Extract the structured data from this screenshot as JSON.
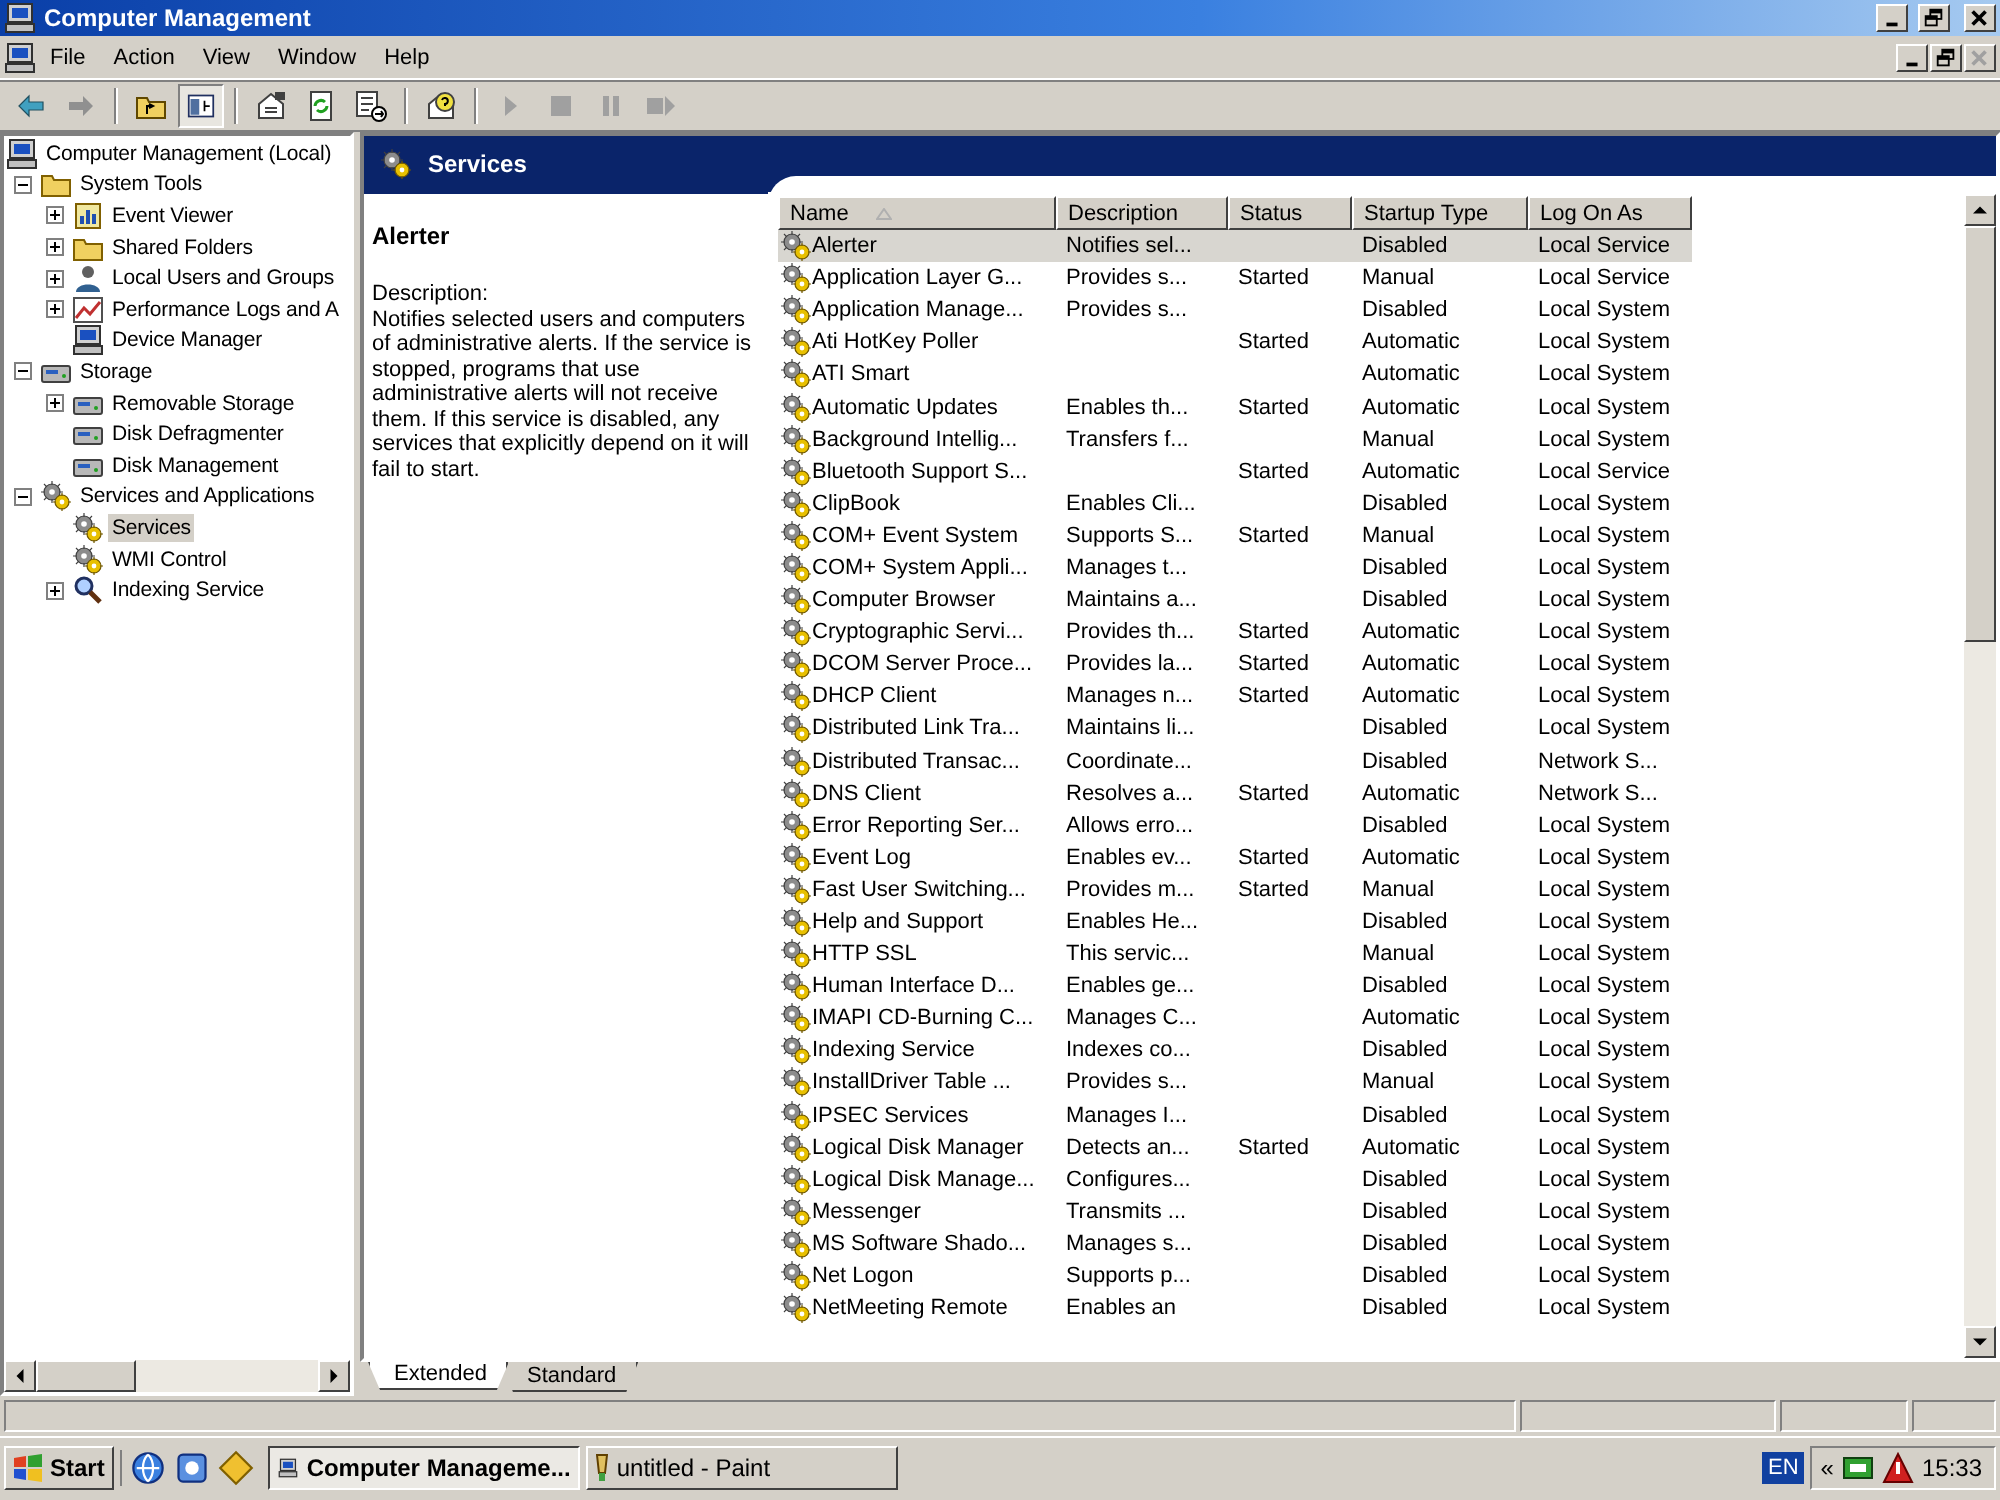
{
  "window": {
    "title": "Computer Management"
  },
  "menu": [
    "File",
    "Action",
    "View",
    "Window",
    "Help"
  ],
  "tree": [
    {
      "label": "Computer Management (Local)",
      "selected": false,
      "children": [
        {
          "label": "System Tools",
          "expanded": true,
          "selected": false,
          "children": [
            {
              "label": "Event Viewer",
              "expanded": false,
              "selected": false
            },
            {
              "label": "Shared Folders",
              "expanded": false,
              "selected": false
            },
            {
              "label": "Local Users and Groups",
              "expanded": false,
              "selected": false
            },
            {
              "label": "Performance Logs and A",
              "expanded": false,
              "selected": false
            },
            {
              "label": "Device Manager",
              "selected": false
            }
          ]
        },
        {
          "label": "Storage",
          "expanded": true,
          "selected": false,
          "children": [
            {
              "label": "Removable Storage",
              "expanded": false,
              "selected": false
            },
            {
              "label": "Disk Defragmenter",
              "selected": false
            },
            {
              "label": "Disk Management",
              "selected": false
            }
          ]
        },
        {
          "label": "Services and Applications",
          "expanded": true,
          "selected": false,
          "children": [
            {
              "label": "Services",
              "selected": true
            },
            {
              "label": "WMI Control",
              "selected": false
            },
            {
              "label": "Indexing Service",
              "expanded": false,
              "selected": false
            }
          ]
        }
      ]
    }
  ],
  "panel": {
    "title": "Services"
  },
  "details": {
    "name": "Alerter",
    "heading": "Description:",
    "text": "Notifies selected users and computers of administrative alerts. If the service is stopped, programs that use administrative alerts will not receive them. If this service is disabled, any services that explicitly depend on it will fail to start."
  },
  "table": {
    "columns": [
      {
        "label": "Name",
        "sorted": true
      },
      {
        "label": "Description",
        "sorted": false
      },
      {
        "label": "Status",
        "sorted": false
      },
      {
        "label": "Startup Type",
        "sorted": false
      },
      {
        "label": "Log On As",
        "sorted": false
      }
    ],
    "rows": [
      {
        "name": "Alerter",
        "description": "Notifies sel...",
        "startup_type": "Disabled",
        "log_on_as": "Local Service",
        "selected": true
      },
      {
        "name": "Application Layer G...",
        "description": "Provides s...",
        "status": "Started",
        "startup_type": "Manual",
        "log_on_as": "Local Service",
        "selected": false
      },
      {
        "name": "Application Manage...",
        "description": "Provides s...",
        "startup_type": "Disabled",
        "log_on_as": "Local System",
        "selected": false
      },
      {
        "name": "Ati HotKey Poller",
        "status": "Started",
        "startup_type": "Automatic",
        "log_on_as": "Local System",
        "selected": false
      },
      {
        "name": "ATI Smart",
        "startup_type": "Automatic",
        "log_on_as": "Local System",
        "selected": false
      },
      {
        "name": "Automatic Updates",
        "description": "Enables th...",
        "status": "Started",
        "startup_type": "Automatic",
        "log_on_as": "Local System",
        "selected": false
      },
      {
        "name": "Background Intellig...",
        "description": "Transfers f...",
        "startup_type": "Manual",
        "log_on_as": "Local System",
        "selected": false
      },
      {
        "name": "Bluetooth Support S...",
        "status": "Started",
        "startup_type": "Automatic",
        "log_on_as": "Local Service",
        "selected": false
      },
      {
        "name": "ClipBook",
        "description": "Enables Cli...",
        "startup_type": "Disabled",
        "log_on_as": "Local System",
        "selected": false
      },
      {
        "name": "COM+ Event System",
        "description": "Supports S...",
        "status": "Started",
        "startup_type": "Manual",
        "log_on_as": "Local System",
        "selected": false
      },
      {
        "name": "COM+ System Appli...",
        "description": "Manages t...",
        "startup_type": "Disabled",
        "log_on_as": "Local System",
        "selected": false
      },
      {
        "name": "Computer Browser",
        "description": "Maintains a...",
        "startup_type": "Disabled",
        "log_on_as": "Local System",
        "selected": false
      },
      {
        "name": "Cryptographic Servi...",
        "description": "Provides th...",
        "status": "Started",
        "startup_type": "Automatic",
        "log_on_as": "Local System",
        "selected": false
      },
      {
        "name": "DCOM Server Proce...",
        "description": "Provides la...",
        "status": "Started",
        "startup_type": "Automatic",
        "log_on_as": "Local System",
        "selected": false
      },
      {
        "name": "DHCP Client",
        "description": "Manages n...",
        "status": "Started",
        "startup_type": "Automatic",
        "log_on_as": "Local System",
        "selected": false
      },
      {
        "name": "Distributed Link Tra...",
        "description": "Maintains li...",
        "startup_type": "Disabled",
        "log_on_as": "Local System",
        "selected": false
      },
      {
        "name": "Distributed Transac...",
        "description": "Coordinate...",
        "startup_type": "Disabled",
        "log_on_as": "Network S...",
        "selected": false
      },
      {
        "name": "DNS Client",
        "description": "Resolves a...",
        "status": "Started",
        "startup_type": "Automatic",
        "log_on_as": "Network S...",
        "selected": false
      },
      {
        "name": "Error Reporting Ser...",
        "description": "Allows erro...",
        "startup_type": "Disabled",
        "log_on_as": "Local System",
        "selected": false
      },
      {
        "name": "Event Log",
        "description": "Enables ev...",
        "status": "Started",
        "startup_type": "Automatic",
        "log_on_as": "Local System",
        "selected": false
      },
      {
        "name": "Fast User Switching...",
        "description": "Provides m...",
        "status": "Started",
        "startup_type": "Manual",
        "log_on_as": "Local System",
        "selected": false
      },
      {
        "name": "Help and Support",
        "description": "Enables He...",
        "startup_type": "Disabled",
        "log_on_as": "Local System",
        "selected": false
      },
      {
        "name": "HTTP SSL",
        "description": "This servic...",
        "startup_type": "Manual",
        "log_on_as": "Local System",
        "selected": false
      },
      {
        "name": "Human Interface D...",
        "description": "Enables ge...",
        "startup_type": "Disabled",
        "log_on_as": "Local System",
        "selected": false
      },
      {
        "name": "IMAPI CD-Burning C...",
        "description": "Manages C...",
        "startup_type": "Automatic",
        "log_on_as": "Local System",
        "selected": false
      },
      {
        "name": "Indexing Service",
        "description": "Indexes co...",
        "startup_type": "Disabled",
        "log_on_as": "Local System",
        "selected": false
      },
      {
        "name": "InstallDriver Table ...",
        "description": "Provides s...",
        "startup_type": "Manual",
        "log_on_as": "Local System",
        "selected": false
      },
      {
        "name": "IPSEC Services",
        "description": "Manages I...",
        "startup_type": "Disabled",
        "log_on_as": "Local System",
        "selected": false
      },
      {
        "name": "Logical Disk Manager",
        "description": "Detects an...",
        "status": "Started",
        "startup_type": "Automatic",
        "log_on_as": "Local System",
        "selected": false
      },
      {
        "name": "Logical Disk Manage...",
        "description": "Configures...",
        "startup_type": "Disabled",
        "log_on_as": "Local System",
        "selected": false
      },
      {
        "name": "Messenger",
        "description": "Transmits ...",
        "startup_type": "Disabled",
        "log_on_as": "Local System",
        "selected": false
      },
      {
        "name": "MS Software Shado...",
        "description": "Manages s...",
        "startup_type": "Disabled",
        "log_on_as": "Local System",
        "selected": false
      },
      {
        "name": "Net Logon",
        "description": "Supports p...",
        "startup_type": "Disabled",
        "log_on_as": "Local System",
        "selected": false
      },
      {
        "name": "NetMeeting Remote",
        "description": "Enables an",
        "startup_type": "Disabled",
        "log_on_as": "Local System",
        "selected": false
      }
    ]
  },
  "view_tabs": [
    {
      "label": "Extended",
      "selected": true
    },
    {
      "label": "Standard",
      "selected": false
    }
  ],
  "taskbar": {
    "start": "Start",
    "tasks": [
      {
        "label": "Computer Manageme...",
        "selected": true
      },
      {
        "label": "untitled - Paint",
        "selected": false
      }
    ],
    "language": "EN",
    "tray_toggle": "«",
    "clock": "15:33"
  }
}
